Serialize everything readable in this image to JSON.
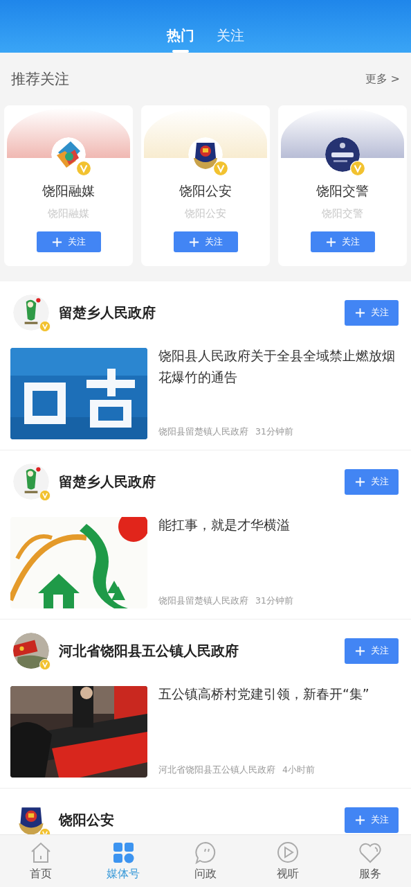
{
  "header": {
    "tabs": [
      {
        "label": "热门",
        "selected": true
      },
      {
        "label": "关注",
        "selected": false
      }
    ]
  },
  "recommended": {
    "title": "推荐关注",
    "more": "更多 >",
    "cards": [
      {
        "kind": "media",
        "name": "饶阳融媒",
        "subtitle": "饶阳融媒",
        "follow": "关注",
        "verified": true
      },
      {
        "kind": "police",
        "name": "饶阳公安",
        "subtitle": "饶阳公安",
        "follow": "关注",
        "verified": true
      },
      {
        "kind": "traffic",
        "name": "饶阳交警",
        "subtitle": "饶阳交警",
        "follow": "关注",
        "verified": true
      }
    ]
  },
  "feed": [
    {
      "avatar": {
        "kind": "village"
      },
      "author": "留楚乡人民政府",
      "follow": "关注",
      "verified": true,
      "article": {
        "title": "饶阳县人民政府关于全县全域禁止燃放烟花爆竹的通告",
        "source": "饶阳县留楚镇人民政府",
        "time": "31分钟前"
      }
    },
    {
      "avatar": {
        "kind": "village"
      },
      "author": "留楚乡人民政府",
      "follow": "关注",
      "verified": true,
      "article": {
        "title": "能扛事，就是才华横溢",
        "source": "饶阳县留楚镇人民政府",
        "time": "31分钟前"
      }
    },
    {
      "avatar": {
        "kind": "party"
      },
      "author": "河北省饶阳县五公镇人民政府",
      "follow": "关注",
      "verified": true,
      "article": {
        "title": "五公镇高桥村党建引领，新春开“集”",
        "source": "河北省饶阳县五公镇人民政府",
        "time": "4小时前"
      }
    },
    {
      "avatar": {
        "kind": "police"
      },
      "author": "饶阳公安",
      "follow": "关注",
      "verified": true
    }
  ],
  "bottom_nav": [
    {
      "kind": "home",
      "label": "首页",
      "selected": false
    },
    {
      "kind": "media",
      "label": "媒体号",
      "selected": true
    },
    {
      "kind": "chat",
      "label": "问政",
      "selected": false
    },
    {
      "kind": "play",
      "label": "视听",
      "selected": false
    },
    {
      "kind": "heart",
      "label": "服务",
      "selected": false
    }
  ]
}
